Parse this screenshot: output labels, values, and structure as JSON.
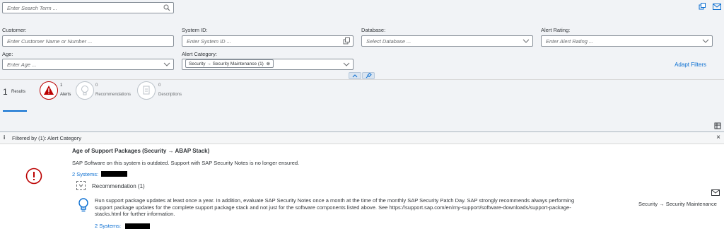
{
  "search": {
    "placeholder": "Enter Search Term ..."
  },
  "filters": {
    "customer": {
      "label": "Customer:",
      "placeholder": "Enter Customer Name or Number ..."
    },
    "system_id": {
      "label": "System ID:",
      "placeholder": "Enter System ID ..."
    },
    "database": {
      "label": "Database:",
      "placeholder": "Select Database ..."
    },
    "alert_rating": {
      "label": "Alert Rating:",
      "placeholder": "Enter Alert Rating ..."
    },
    "age": {
      "label": "Age:",
      "placeholder": "Enter Age ..."
    },
    "alert_category": {
      "label": "Alert Category:",
      "token": "Security → Security Maintenance (1)"
    },
    "adapt_label": "Adapt Filters"
  },
  "tabs": {
    "results": {
      "count": "1",
      "label": "Results"
    },
    "alerts": {
      "count": "1",
      "label": "Alerts"
    },
    "recommendations": {
      "count": "0",
      "label": "Recommendations"
    },
    "descriptions": {
      "count": "0",
      "label": "Descriptions"
    }
  },
  "infobar": {
    "text": "Filtered by (1): Alert Category",
    "close": "×",
    "info_glyph": "i"
  },
  "alert": {
    "title": "Age of Support Packages (Security → ABAP Stack)",
    "description": "SAP Software on this system is outdated. Support with SAP Security Notes is no longer ensured.",
    "systems_link": "2 Systems:",
    "recommendation_title": "Recommendation (1)",
    "recommendation_text": "Run support package updates at least once a year. In addition, evaluate SAP Security Notes once a month at the time of the monthly SAP Security Patch Day. SAP strongly recommends always performing support package updates for the complete support package stack and not just for the software components listed above. See https://support.sap.com/en/my-support/software-downloads/support-package-stacks.html for further information.",
    "rec_systems_link": "2 Systems:",
    "category": "Security → Security Maintenance"
  },
  "colors": {
    "accent": "#0a6ed1",
    "error": "#bb0000",
    "header_bg": "#f1f3f6"
  }
}
